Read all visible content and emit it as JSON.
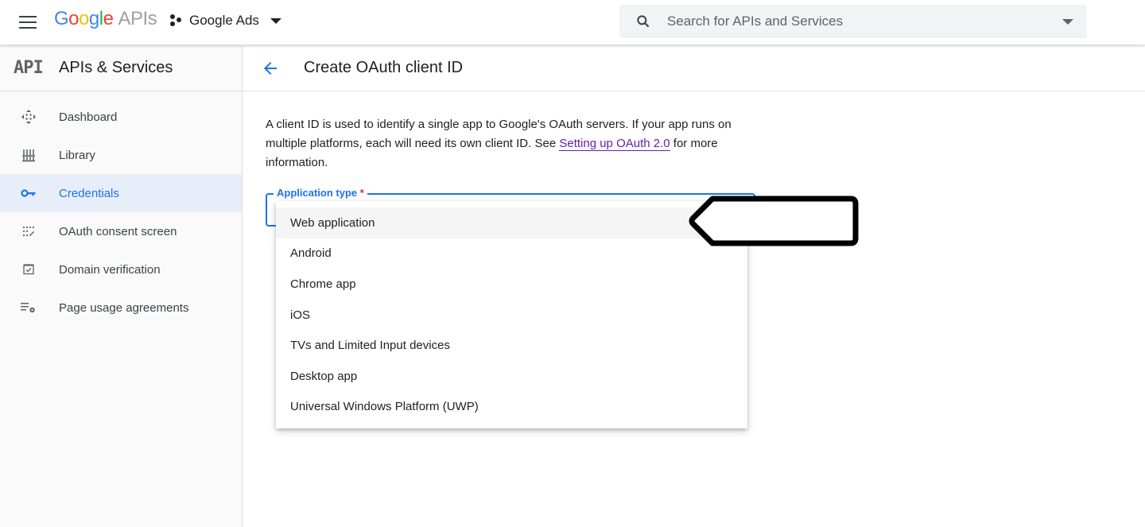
{
  "topbar": {
    "logo_letters": [
      "G",
      "o",
      "o",
      "g",
      "l",
      "e"
    ],
    "logo_suffix": "APIs",
    "project_name": "Google Ads",
    "search_placeholder": "Search for APIs and Services"
  },
  "sidebar": {
    "logo_text": "API",
    "title": "APIs & Services",
    "items": [
      {
        "label": "Dashboard",
        "icon": "dashboard-icon",
        "active": false
      },
      {
        "label": "Library",
        "icon": "library-icon",
        "active": false
      },
      {
        "label": "Credentials",
        "icon": "key-icon",
        "active": true
      },
      {
        "label": "OAuth consent screen",
        "icon": "consent-icon",
        "active": false
      },
      {
        "label": "Domain verification",
        "icon": "checkbox-icon",
        "active": false
      },
      {
        "label": "Page usage agreements",
        "icon": "list-settings-icon",
        "active": false
      }
    ]
  },
  "main": {
    "title": "Create OAuth client ID",
    "description_pre": "A client ID is used to identify a single app to Google's OAuth servers. If your app runs on multiple platforms, each will need its own client ID. See ",
    "description_link": "Setting up OAuth 2.0",
    "description_post": " for more information.",
    "field_label": "Application type",
    "required_marker": "*",
    "dropdown_options": [
      "Web application",
      "Android",
      "Chrome app",
      "iOS",
      "TVs and Limited Input devices",
      "Desktop app",
      "Universal Windows Platform (UWP)"
    ],
    "highlighted_option": "Web application"
  },
  "colors": {
    "accent": "#1a73e8",
    "link_visited": "#681da8",
    "required": "#d93025",
    "active_nav_bg": "#e8eef9"
  }
}
